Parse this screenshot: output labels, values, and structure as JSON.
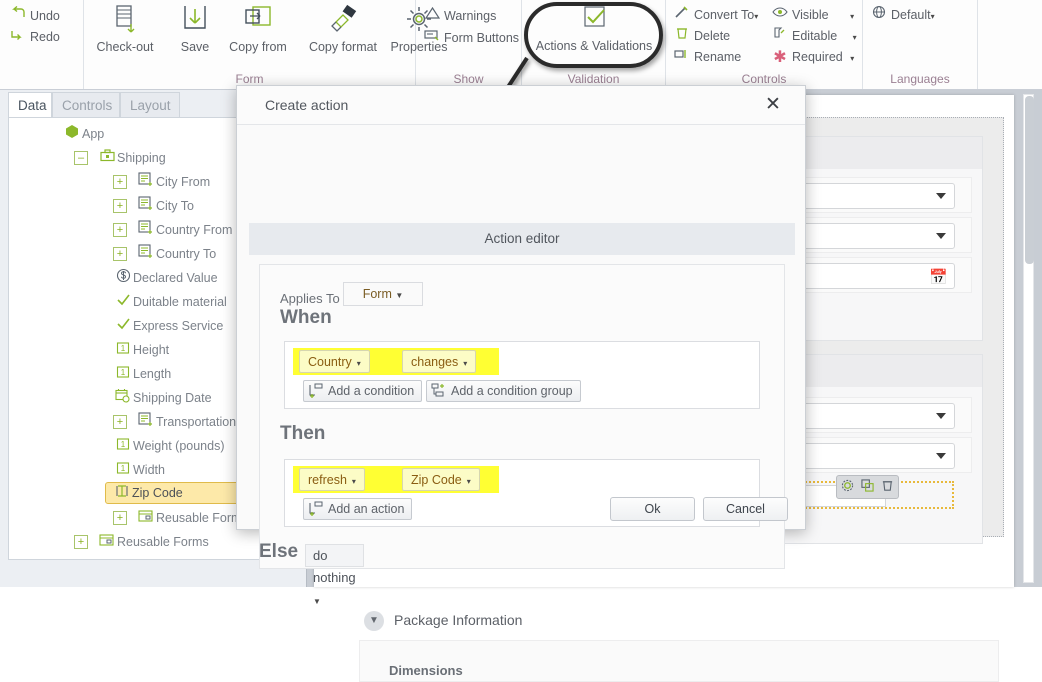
{
  "ribbon": {
    "quick": [
      {
        "label": "Undo",
        "icon": "undo-arrow-icon"
      },
      {
        "label": "Redo",
        "icon": "redo-arrow-icon"
      }
    ],
    "groups": [
      {
        "name": "Form",
        "label": "Form"
      },
      {
        "name": "Show",
        "label": "Show"
      },
      {
        "name": "Validation",
        "label": "Validation"
      },
      {
        "name": "Controls",
        "label": "Controls"
      },
      {
        "name": "Languages",
        "label": "Languages"
      }
    ],
    "form_buttons": [
      {
        "label": "Check-out",
        "icon": "checkout-icon"
      },
      {
        "label": "Save",
        "icon": "save-download-icon"
      },
      {
        "label": "Copy from",
        "icon": "copy-from-icon"
      },
      {
        "label": "Copy format",
        "icon": "paintbrush-icon"
      },
      {
        "label": "Properties",
        "icon": "gear-icon"
      }
    ],
    "show_buttons": [
      {
        "label": "Warnings",
        "icon": "warning-triangle-icon"
      },
      {
        "label": "Form Buttons",
        "icon": "form-buttons-icon"
      }
    ],
    "validation_button": {
      "label": "Actions & Validations",
      "icon": "checkmark-box-icon"
    },
    "controls_buttons": [
      {
        "label": "Convert To",
        "icon": "convert-wand-icon",
        "caret": "▾"
      },
      {
        "label": "Delete",
        "icon": "trash-icon",
        "caret": ""
      },
      {
        "label": "Rename",
        "icon": "rename-icon",
        "caret": ""
      },
      {
        "label": "Visible",
        "icon": "eye-icon",
        "caret": "▾"
      },
      {
        "label": "Editable",
        "icon": "editable-pencil-icon",
        "caret": "▾"
      },
      {
        "label": "Required",
        "icon": "required-asterisk-icon",
        "caret": "▾"
      }
    ],
    "languages_button": {
      "label": "Default",
      "icon": "globe-icon",
      "caret": "▾"
    }
  },
  "left_panel": {
    "tabs": [
      {
        "label": "Data",
        "active": true
      },
      {
        "label": "Controls",
        "active": false
      },
      {
        "label": "Layout",
        "active": false
      }
    ],
    "tree": [
      {
        "label": "App",
        "icon": "app-cube-icon",
        "indent": 0,
        "expander": ""
      },
      {
        "label": "Shipping",
        "icon": "briefcase-icon",
        "indent": 1,
        "expander": "–"
      },
      {
        "label": "City From",
        "icon": "lookup-field-icon",
        "indent": 2,
        "expander": "+"
      },
      {
        "label": "City To",
        "icon": "lookup-field-icon",
        "indent": 2,
        "expander": "+"
      },
      {
        "label": "Country From",
        "icon": "lookup-field-icon",
        "indent": 2,
        "expander": "+"
      },
      {
        "label": "Country To",
        "icon": "lookup-field-icon",
        "indent": 2,
        "expander": "+"
      },
      {
        "label": "Declared Value",
        "icon": "currency-icon",
        "indent": 2,
        "expander": ""
      },
      {
        "label": "Duitable material",
        "icon": "checkbox-check-icon",
        "indent": 2,
        "expander": ""
      },
      {
        "label": "Express Service",
        "icon": "checkbox-check-icon",
        "indent": 2,
        "expander": ""
      },
      {
        "label": "Height",
        "icon": "number-field-icon",
        "indent": 2,
        "expander": ""
      },
      {
        "label": "Length",
        "icon": "number-field-icon",
        "indent": 2,
        "expander": ""
      },
      {
        "label": "Shipping Date",
        "icon": "calendar-clock-icon",
        "indent": 2,
        "expander": ""
      },
      {
        "label": "Transportation Mean",
        "icon": "lookup-field-icon",
        "indent": 2,
        "expander": "+"
      },
      {
        "label": "Weight (pounds)",
        "icon": "number-field-icon",
        "indent": 2,
        "expander": ""
      },
      {
        "label": "Width",
        "icon": "number-field-icon",
        "indent": 2,
        "expander": ""
      },
      {
        "label": "Zip Code",
        "icon": "text-field-icon",
        "indent": 2,
        "expander": "",
        "selected": true
      },
      {
        "label": "Reusable Forms",
        "icon": "reusable-form-icon",
        "indent": 2,
        "expander": "+"
      },
      {
        "label": "Reusable Forms",
        "icon": "reusable-form-icon",
        "indent": 1,
        "expander": "+"
      }
    ]
  },
  "background_form": {
    "package_section_title": "Package Information",
    "dimensions_label": "Dimensions",
    "selection_tools": [
      {
        "icon": "gear-icon"
      },
      {
        "icon": "copy-icon"
      },
      {
        "icon": "trash-icon"
      }
    ]
  },
  "dialog": {
    "title": "Create action",
    "close_icon": "close-icon",
    "subbar": "Action editor",
    "applies_to_label": "Applies To",
    "applies_to_value": "Form",
    "when_label": "When",
    "then_label": "Then",
    "else_label": "Else",
    "else_value": "do nothing",
    "when_chips": [
      {
        "label": "Country",
        "caret": "▾"
      },
      {
        "label": "changes",
        "caret": "▾"
      }
    ],
    "when_buttons": [
      {
        "label": "Add a condition",
        "icon": "add-condition-icon"
      },
      {
        "label": "Add a condition group",
        "icon": "add-condition-group-icon"
      }
    ],
    "then_chips": [
      {
        "label": "refresh",
        "caret": "▾"
      },
      {
        "label": "Zip Code",
        "caret": "▾"
      }
    ],
    "then_buttons": [
      {
        "label": "Add an action",
        "icon": "add-action-icon"
      }
    ],
    "ok_label": "Ok",
    "cancel_label": "Cancel"
  },
  "colors": {
    "accent_green": "#8cb82b",
    "highlight_yellow": "#ffff33",
    "selection_amber": "#fde9a9",
    "group_label": "#9a7f92"
  }
}
